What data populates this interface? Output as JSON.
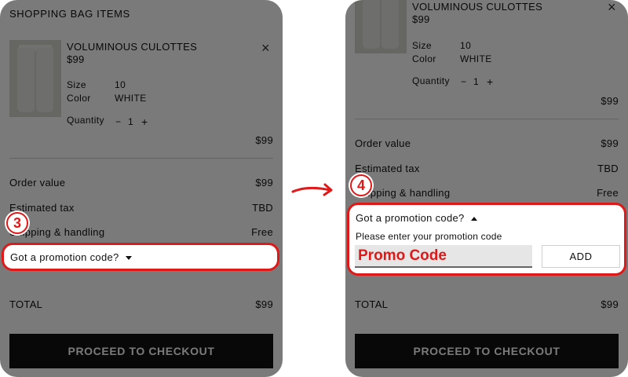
{
  "left": {
    "heading": "SHOPPING BAG ITEMS",
    "product": {
      "name": "VOLUMINOUS CULOTTES",
      "price": "$99",
      "size_label": "Size",
      "size_value": "10",
      "color_label": "Color",
      "color_value": "WHITE",
      "quantity_label": "Quantity",
      "quantity_value": "1",
      "minus": "−",
      "plus": "+",
      "line_total": "$99"
    },
    "summary": [
      {
        "label": "Order value",
        "value": "$99"
      },
      {
        "label": "Estimated tax",
        "value": "TBD"
      },
      {
        "label": "Shipping & handling",
        "value": "Free"
      }
    ],
    "promo_toggle": "Got a promotion code?",
    "total_label": "TOTAL",
    "total_value": "$99",
    "checkout": "PROCEED TO CHECKOUT",
    "step": "3"
  },
  "right": {
    "product": {
      "name": "VOLUMINOUS CULOTTES",
      "price": "$99",
      "size_label": "Size",
      "size_value": "10",
      "color_label": "Color",
      "color_value": "WHITE",
      "quantity_label": "Quantity",
      "quantity_value": "1",
      "minus": "−",
      "plus": "+",
      "line_total": "$99"
    },
    "summary": [
      {
        "label": "Order value",
        "value": "$99"
      },
      {
        "label": "Estimated tax",
        "value": "TBD"
      },
      {
        "label": "Shipping & handling",
        "value": "Free"
      }
    ],
    "promo_toggle": "Got a promotion code?",
    "promo_prompt": "Please enter your promotion code",
    "promo_placeholder": "Promo Code",
    "add_button": "ADD",
    "total_label": "TOTAL",
    "total_value": "$99",
    "checkout": "PROCEED TO CHECKOUT",
    "step": "4"
  },
  "icons": {
    "close": "close-icon",
    "arrow": "arrow-right-icon",
    "caret_down": "caret-down-icon",
    "caret_up": "caret-up-icon"
  },
  "colors": {
    "accent": "#e01818",
    "dim_overlay": "rgba(0,0,0,0.52)",
    "checkout_bg": "#111111"
  }
}
